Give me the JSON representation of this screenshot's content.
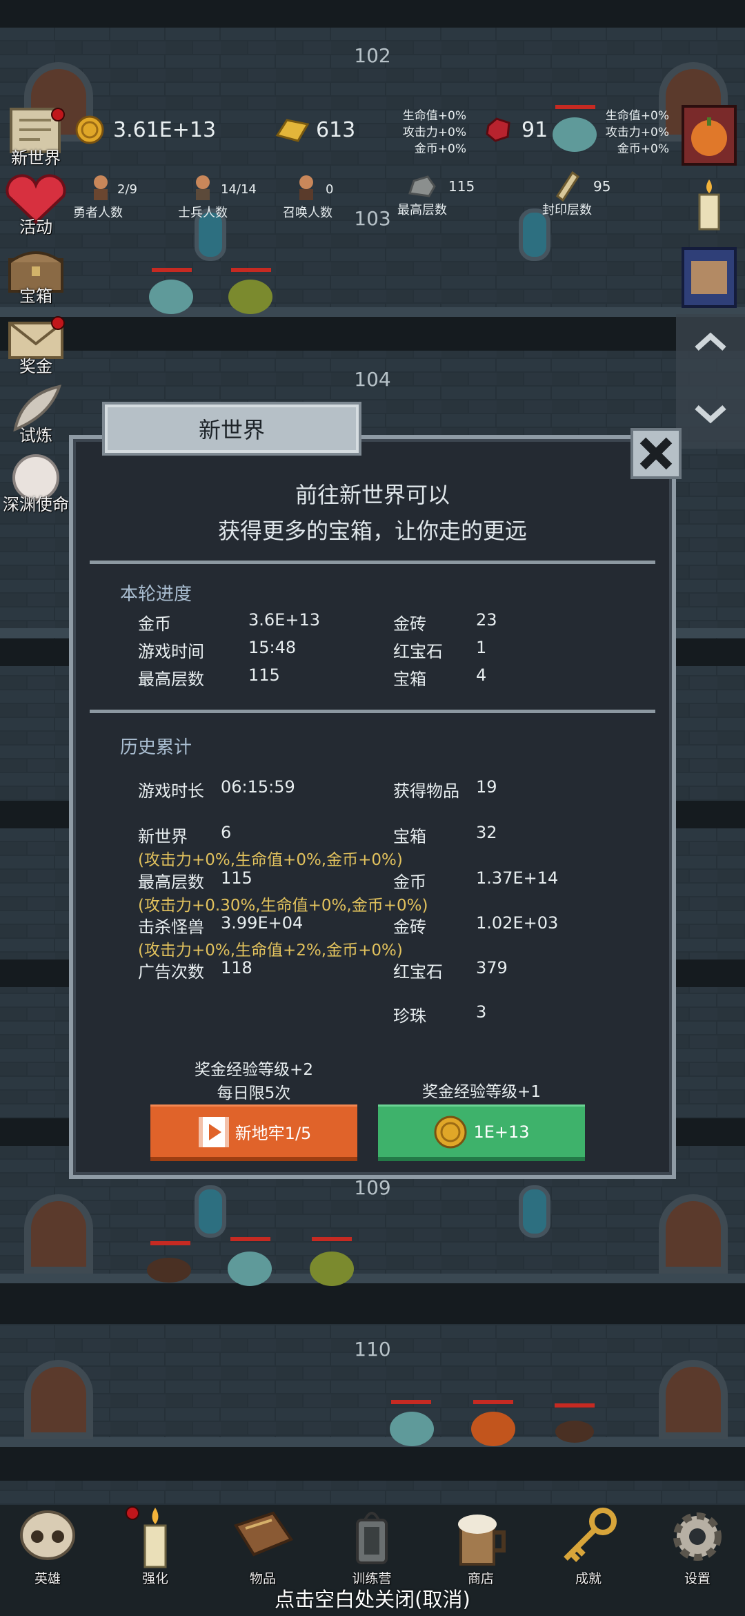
{
  "floors": [
    "102",
    "103",
    "104",
    "109",
    "110"
  ],
  "hud": {
    "gold": "3.61E+13",
    "gold_bar": "613",
    "gold_bar_bonus": [
      "生命值+0%",
      "攻击力+0%",
      "金币+0%"
    ],
    "ruby": "91",
    "ruby_bonus": [
      "生命值+0%",
      "攻击力+0%",
      "金币+0%"
    ],
    "heroes": {
      "value": "2/9",
      "label": "勇者人数"
    },
    "soldiers": {
      "value": "14/14",
      "label": "士兵人数"
    },
    "summons": {
      "value": "0",
      "label": "召唤人数"
    },
    "max_floor": {
      "value": "115",
      "label": "最高层数"
    },
    "sealed_floor": {
      "value": "95",
      "label": "封印层数"
    }
  },
  "side_menu": [
    {
      "label": "新世界",
      "icon": "scroll-map-icon",
      "badge": true
    },
    {
      "label": "活动",
      "icon": "heart-icon",
      "badge": false
    },
    {
      "label": "宝箱",
      "icon": "treasure-chest-icon",
      "badge": false
    },
    {
      "label": "奖金",
      "icon": "envelope-icon",
      "badge": true
    },
    {
      "label": "试炼",
      "icon": "feather-icon",
      "badge": false
    },
    {
      "label": "深渊使命",
      "icon": "pearl-icon",
      "badge": false
    }
  ],
  "modal": {
    "title": "新世界",
    "lead_1": "前往新世界可以",
    "lead_2": "获得更多的宝箱，让你走的更远",
    "round_title": "本轮进度",
    "round": {
      "gold_label": "金币",
      "gold": "3.6E+13",
      "brick_label": "金砖",
      "brick": "23",
      "time_label": "游戏时间",
      "time": "15:48",
      "ruby_label": "红宝石",
      "ruby": "1",
      "floor_label": "最高层数",
      "floor": "115",
      "chest_label": "宝箱",
      "chest": "4"
    },
    "history_title": "历史累计",
    "history": {
      "duration_label": "游戏时长",
      "duration": "06:15:59",
      "items_label": "获得物品",
      "items": "19",
      "newworld_label": "新世界",
      "newworld": "6",
      "chest_label": "宝箱",
      "chest": "32",
      "bonus_1": "(攻击力+0%,生命值+0%,金币+0%)",
      "floor_label": "最高层数",
      "floor": "115",
      "gold_label": "金币",
      "gold": "1.37E+14",
      "bonus_2": "(攻击力+0.30%,生命值+0%,金币+0%)",
      "kills_label": "击杀怪兽",
      "kills": "3.99E+04",
      "brick_label": "金砖",
      "brick": "1.02E+03",
      "bonus_3": "(攻击力+0%,生命值+2%,金币+0%)",
      "ads_label": "广告次数",
      "ads": "118",
      "ruby_label": "红宝石",
      "ruby": "379",
      "pearl_label": "珍珠",
      "pearl": "3"
    },
    "ad_caption_1": "奖金经验等级+2",
    "ad_caption_2": "每日限5次",
    "coin_caption": "奖金经验等级+1",
    "ad_button": "新地牢1/5",
    "coin_button": "1E+13"
  },
  "bottom_nav": [
    {
      "label": "英雄",
      "icon": "skull-icon"
    },
    {
      "label": "强化",
      "icon": "candle-icon"
    },
    {
      "label": "物品",
      "icon": "book-icon"
    },
    {
      "label": "训练营",
      "icon": "lantern-icon"
    },
    {
      "label": "商店",
      "icon": "mug-icon"
    },
    {
      "label": "成就",
      "icon": "key-icon"
    },
    {
      "label": "设置",
      "icon": "gear-icon"
    }
  ],
  "close_hint": "点击空白处关闭(取消)",
  "colors": {
    "bg": "#1a2126",
    "modal_bg": "#242a32",
    "bonus_text": "#e2c25d",
    "ad_button": "#e0632a",
    "coin_button": "#3eb26b",
    "badge_red": "#c0161b"
  }
}
